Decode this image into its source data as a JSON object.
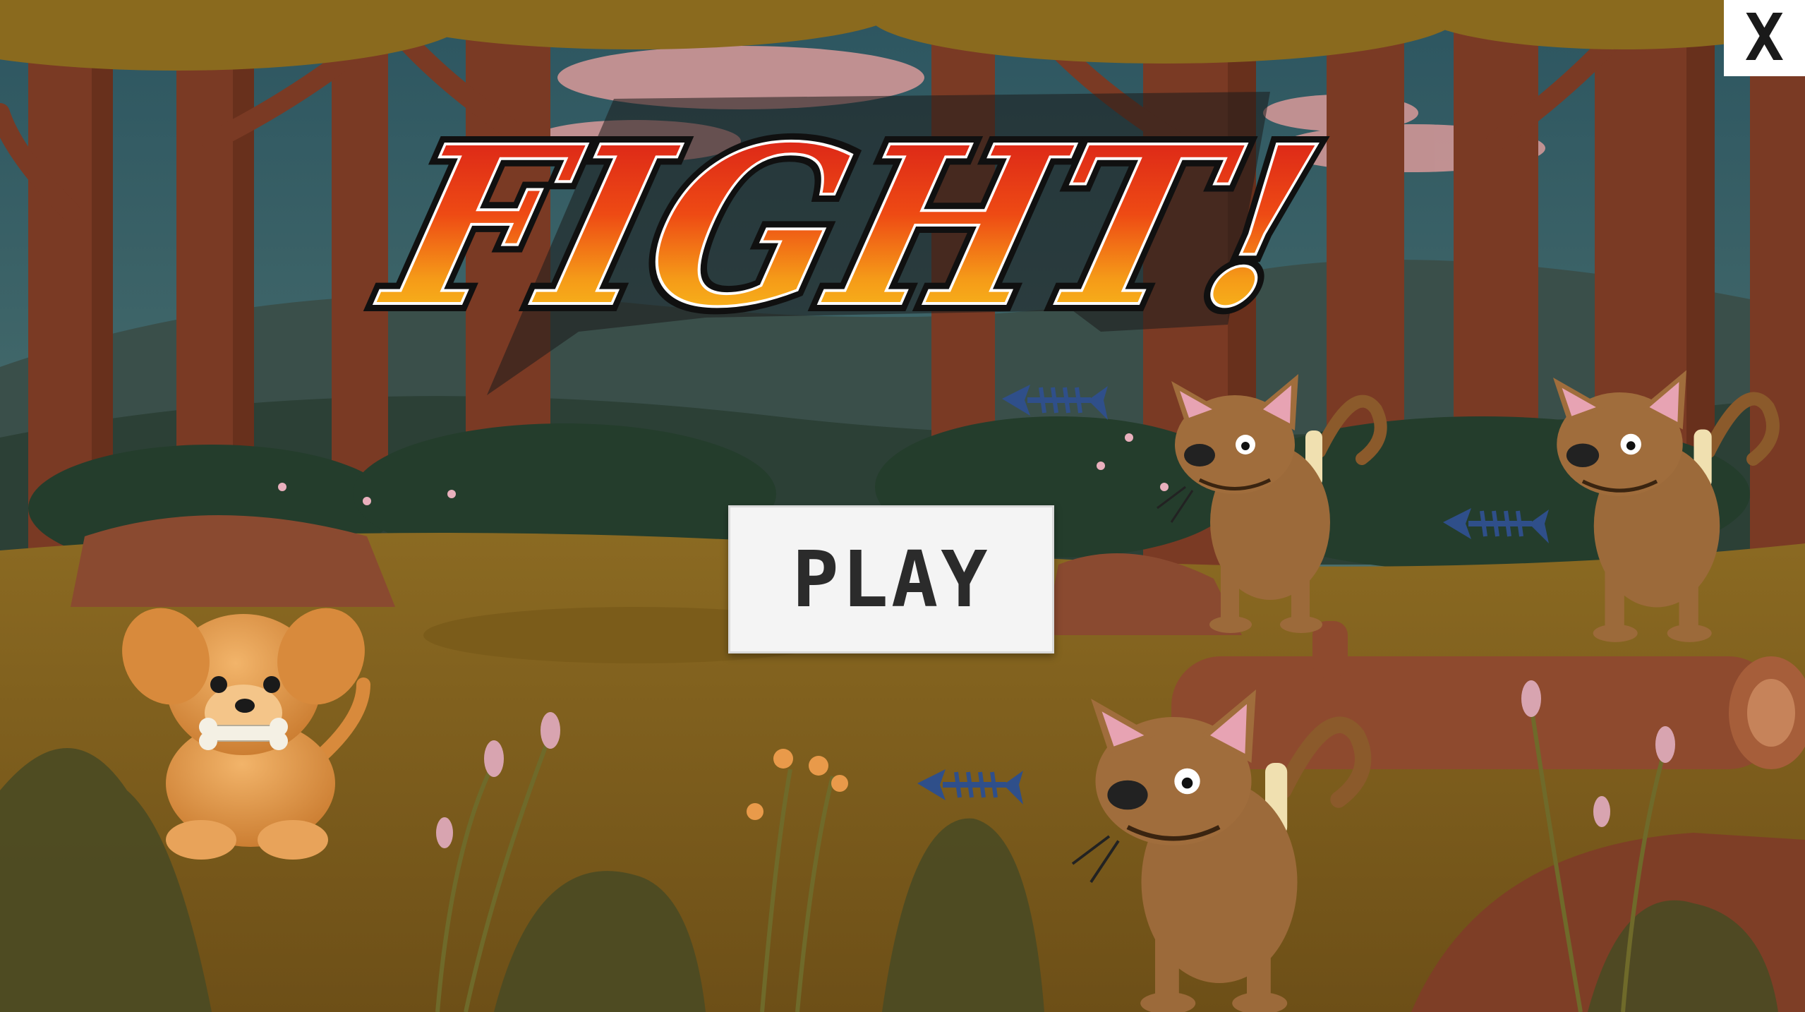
{
  "game": {
    "title_logo_text": "FIGHT!",
    "play_label": "PLAY",
    "close_label": "X"
  },
  "characters": {
    "player": "puppy-with-bone",
    "enemies": [
      "pirate-cat",
      "pirate-cat",
      "pirate-cat"
    ],
    "pickups": [
      "fish-bone",
      "fish-bone",
      "fish-bone"
    ]
  },
  "colors": {
    "sky": "#2f5560",
    "ground": "#7a5c1e",
    "play_button_bg": "#f4f4f4",
    "logo_red": "#d8201a",
    "logo_orange": "#f08c1a"
  }
}
